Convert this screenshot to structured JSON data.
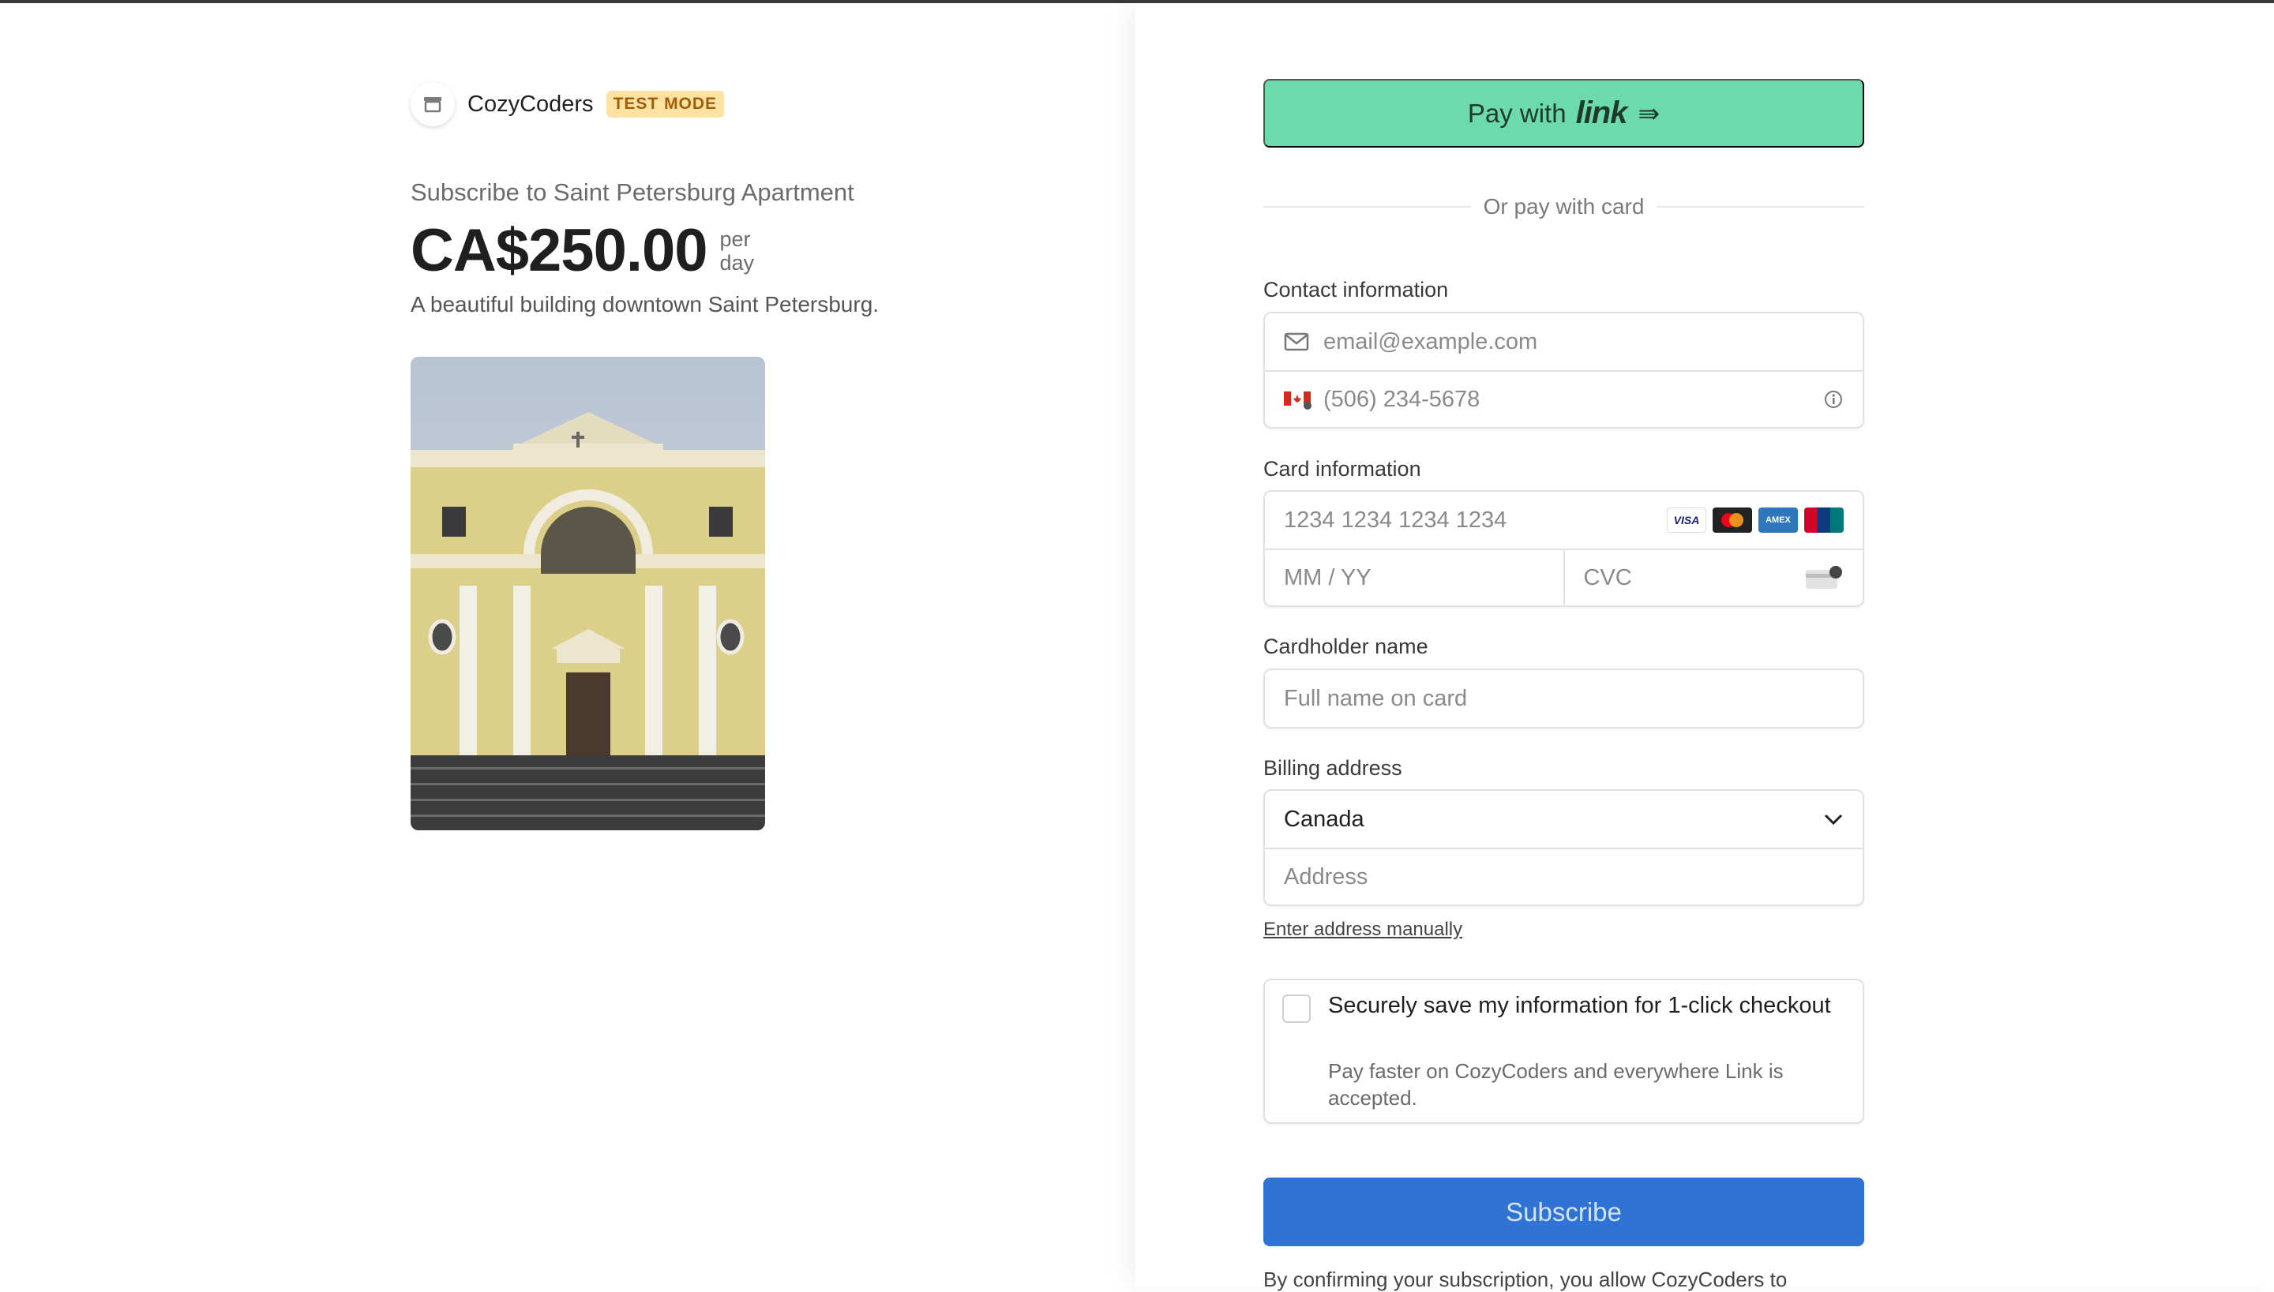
{
  "merchant": {
    "name": "CozyCoders",
    "badge": "TEST MODE"
  },
  "product": {
    "subtitle": "Subscribe to Saint Petersburg Apartment",
    "price": "CA$250.00",
    "period_line1": "per",
    "period_line2": "day",
    "description": "A beautiful building downtown Saint Petersburg."
  },
  "link_button": {
    "prefix": "Pay with",
    "brand": "link",
    "arrow": "⇛"
  },
  "divider_text": "Or pay with card",
  "contact": {
    "label": "Contact information",
    "email_placeholder": "email@example.com",
    "phone_placeholder": "(506) 234-5678",
    "country_flag_icon": "canada-flag-icon",
    "info_icon": "info-icon"
  },
  "card": {
    "label": "Card information",
    "number_placeholder": "1234 1234 1234 1234",
    "expiry_placeholder": "MM / YY",
    "cvc_placeholder": "CVC",
    "brands": [
      "VISA",
      "Mastercard",
      "AMEX",
      "UnionPay"
    ]
  },
  "cardholder": {
    "label": "Cardholder name",
    "placeholder": "Full name on card"
  },
  "billing": {
    "label": "Billing address",
    "country": "Canada",
    "address_placeholder": "Address",
    "manual_link": "Enter address manually"
  },
  "save_info": {
    "title": "Securely save my information for 1-click checkout",
    "subtitle": "Pay faster on CozyCoders and everywhere Link is accepted.",
    "checked": false
  },
  "subscribe_label": "Subscribe",
  "terms_text": "By confirming your subscription, you allow CozyCoders to",
  "colors": {
    "link_green": "#6ddaae",
    "subscribe_blue": "#2f73d4",
    "badge_bg": "#fde2a3",
    "badge_text": "#a15c06"
  }
}
